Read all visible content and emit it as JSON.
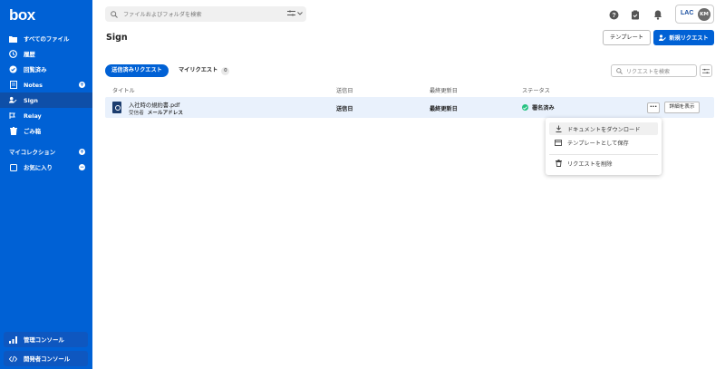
{
  "app": {
    "logo": "box"
  },
  "sidebar": {
    "items": [
      {
        "label": "すべてのファイル",
        "icon": "folder-icon"
      },
      {
        "label": "履歴",
        "icon": "clock-icon"
      },
      {
        "label": "回覧済み",
        "icon": "check-circle-icon"
      },
      {
        "label": "Notes",
        "icon": "notes-icon"
      },
      {
        "label": "Sign",
        "icon": "sign-icon"
      },
      {
        "label": "Relay",
        "icon": "relay-icon"
      },
      {
        "label": "ごみ箱",
        "icon": "trash-icon"
      }
    ],
    "collections": {
      "label": "マイコレクション"
    },
    "favorites": {
      "label": "お気に入り"
    },
    "admin_console": "管理コンソール",
    "dev_console": "開発者コンソール"
  },
  "topbar": {
    "search_placeholder": "ファイルおよびフォルダを検索",
    "lac": "LAC",
    "avatar": "KM"
  },
  "page": {
    "title": "Sign",
    "template_button": "テンプレート",
    "new_request_button": "新規リクエスト"
  },
  "tabs": {
    "sent": "送信済みリクエスト",
    "mine": "マイリクエスト",
    "mine_count": "0",
    "search_placeholder": "リクエストを検索"
  },
  "table": {
    "headers": [
      "タイトル",
      "送信日",
      "最終更新日",
      "ステータス"
    ],
    "rows": [
      {
        "file_name": "入社時の規約書.pdf",
        "recipient_label": "受信者",
        "recipient_value": "メールアドレス",
        "sent_date": "送信日",
        "last_updated": "最終更新日",
        "status": "署名済み",
        "detail_button": "詳細を表示"
      }
    ]
  },
  "menu": {
    "download": "ドキュメントをダウンロード",
    "save_template": "テンプレートとして保存",
    "delete": "リクエストを削除"
  },
  "colors": {
    "brand": "#0061d5",
    "status_signed": "#26c281"
  }
}
